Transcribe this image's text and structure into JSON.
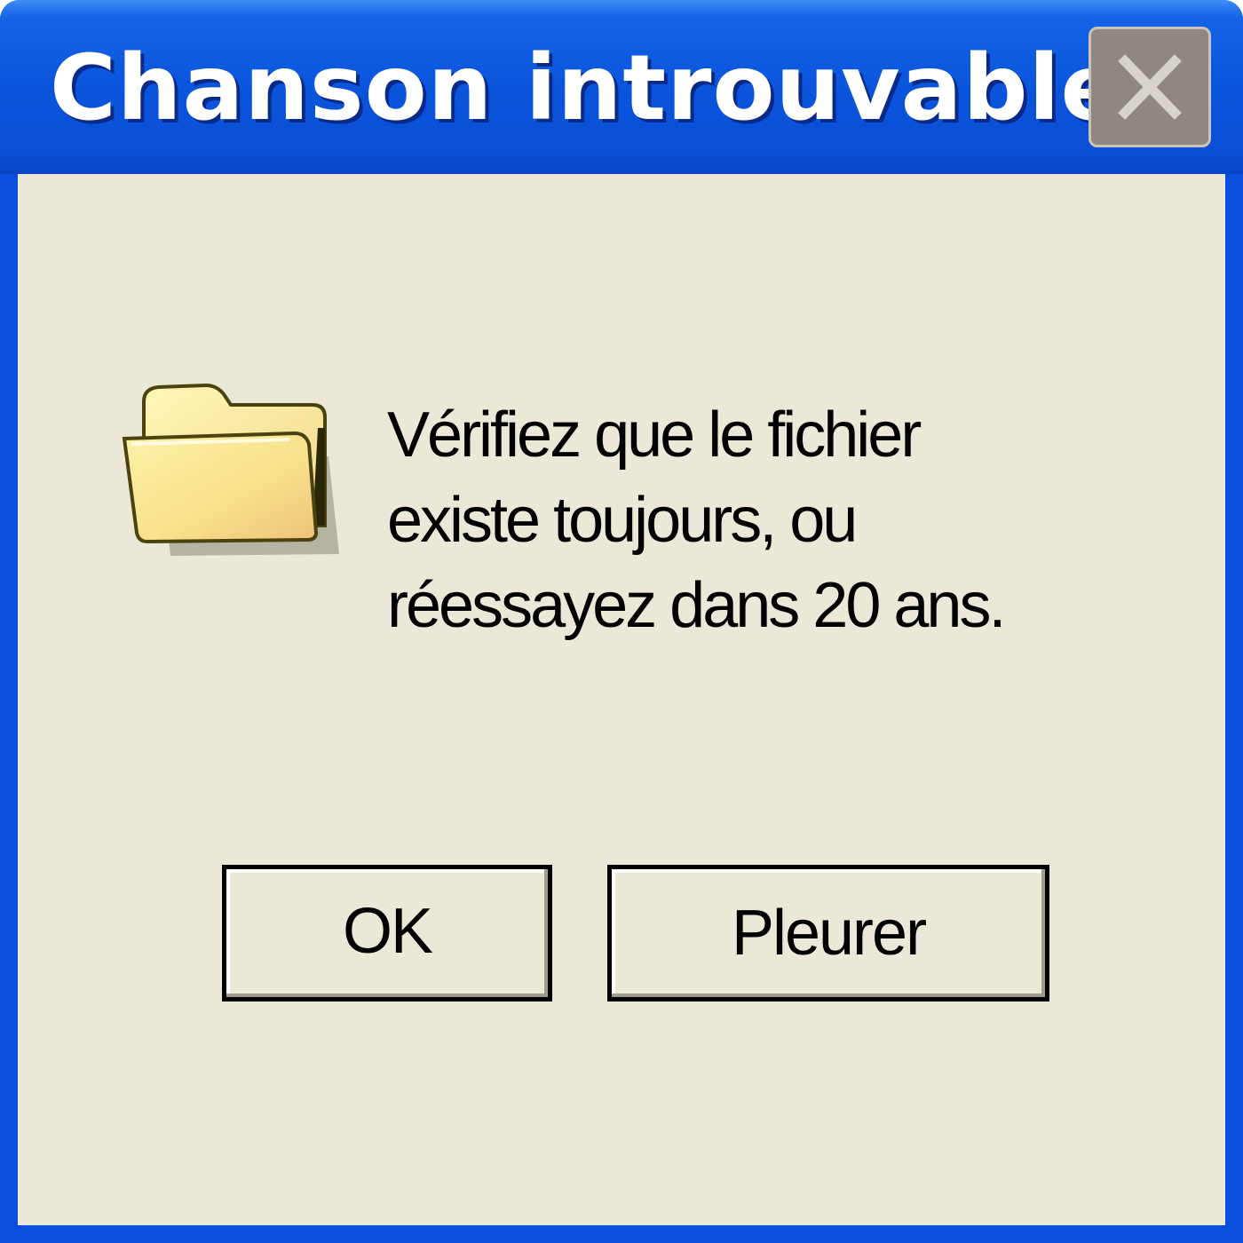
{
  "window": {
    "title": "Chanson introuvable",
    "close_icon": "close-icon",
    "titlebar_color": "#0a4fde",
    "client_color": "#ebe8d8"
  },
  "dialog": {
    "icon": "folder-icon",
    "message_lines": [
      "Vérifiez que le fichier",
      "existe toujours, ou",
      "réessayez dans 20 ans."
    ]
  },
  "buttons": {
    "ok_label": "OK",
    "cry_label": "Pleurer"
  }
}
